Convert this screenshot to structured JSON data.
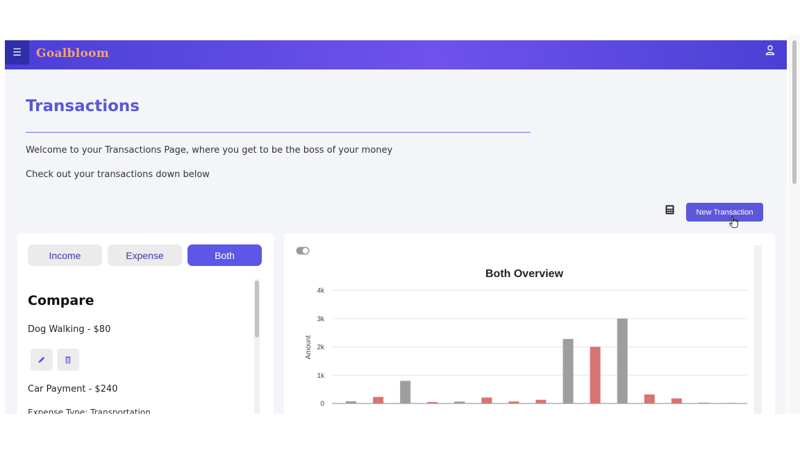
{
  "app": {
    "logo_text": "Goalbloom",
    "menu_icon": "hamburger-menu-icon",
    "user_icon": "user-icon"
  },
  "page": {
    "title": "Transactions",
    "intro_line_1": "Welcome to your Transactions Page, where you get to be the boss of your money",
    "intro_line_2": "Check out your transactions down below"
  },
  "actions": {
    "calculator_icon": "calculator-icon",
    "new_transaction_label": "New Transaction"
  },
  "filter_tabs": [
    {
      "label": "Income",
      "selected": false
    },
    {
      "label": "Expense",
      "selected": false
    },
    {
      "label": "Both",
      "selected": true
    }
  ],
  "list": {
    "heading": "Compare",
    "items": [
      {
        "label": "Dog Walking - $80"
      },
      {
        "label": "Car Payment - $240",
        "detail": "Expense Type: Transportation"
      }
    ]
  },
  "colors": {
    "accent": "#5c57e6",
    "header_start": "#4a3fd8",
    "header_mid": "#6f52ee",
    "income_bar": "#9e9e9e",
    "expense_bar": "#d97373"
  },
  "chart_data": {
    "type": "bar",
    "title": "Both Overview",
    "ylabel": "Amount",
    "xlabel": "",
    "ylim": [
      0,
      4000
    ],
    "yticks": [
      0,
      1000,
      2000,
      3000,
      4000
    ],
    "ytick_labels": [
      "0",
      "1k",
      "2k",
      "3k",
      "4k"
    ],
    "grid": true,
    "legend": "none",
    "colors": [
      "#9e9e9e",
      "#d97373"
    ],
    "values": [
      {
        "value": 80,
        "kind": "income"
      },
      {
        "value": 230,
        "kind": "expense"
      },
      {
        "value": 800,
        "kind": "income"
      },
      {
        "value": 50,
        "kind": "expense"
      },
      {
        "value": 70,
        "kind": "income"
      },
      {
        "value": 210,
        "kind": "expense"
      },
      {
        "value": 70,
        "kind": "expense"
      },
      {
        "value": 130,
        "kind": "expense"
      },
      {
        "value": 2280,
        "kind": "income"
      },
      {
        "value": 2000,
        "kind": "expense"
      },
      {
        "value": 3000,
        "kind": "income"
      },
      {
        "value": 320,
        "kind": "expense"
      },
      {
        "value": 180,
        "kind": "expense"
      },
      {
        "value": 30,
        "kind": "income"
      },
      {
        "value": 20,
        "kind": "income"
      }
    ]
  }
}
